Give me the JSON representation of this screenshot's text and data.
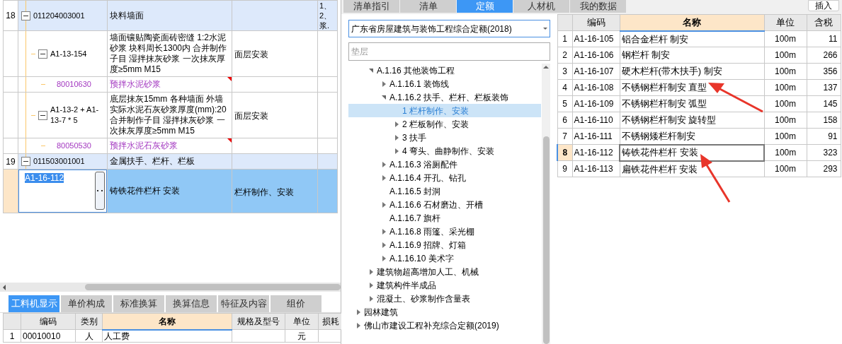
{
  "bill_table": {
    "rows": [
      {
        "kind": "item",
        "number": "18",
        "code": "011204003001",
        "name": "块料墙面",
        "content_lines": [
          "1、",
          "2、",
          "浆."
        ],
        "selected": false,
        "children": [
          {
            "kind": "quota",
            "code": "A1-13-154",
            "name": "墙面镶贴陶瓷面砖密缝 1:2水泥砂浆 块料周长1300内  合并制作子目 湿拌抹灰砂浆 一次抹灰厚度≥5mm M15",
            "feature": "面层安装",
            "selected": false,
            "children": [
              {
                "kind": "material",
                "code": "80010630",
                "name": "预拌水泥砂浆",
                "selected": false
              }
            ]
          },
          {
            "kind": "quota",
            "code": "A1-13-2 + A1-13-7 * 5",
            "name": "底层抹灰15mm 各种墙面 外墙实际水泥石灰砂浆厚度(mm):20  合并制作子目 湿拌抹灰砂浆 一次抹灰厚度≥5mm M15",
            "feature": "面层安装",
            "selected": false,
            "children": [
              {
                "kind": "material",
                "code": "80050530",
                "name": "预拌水泥石灰砂浆",
                "selected": false
              }
            ]
          }
        ]
      },
      {
        "kind": "item",
        "number": "19",
        "code": "011503001001",
        "name": "金属扶手、栏杆、栏板",
        "selected": false,
        "children": [
          {
            "kind": "editing",
            "code": "A1-16-112",
            "name": "铸铁花件栏杆 安装",
            "feature": "栏杆制作、安装",
            "selected": true
          }
        ]
      }
    ]
  },
  "detail_tabs": [
    {
      "label": "工料机显示",
      "selected": true
    },
    {
      "label": "单价构成",
      "selected": false
    },
    {
      "label": "标准换算",
      "selected": false
    },
    {
      "label": "换算信息",
      "selected": false
    },
    {
      "label": "特征及内容",
      "selected": false
    },
    {
      "label": "组价",
      "selected": false
    }
  ],
  "resource_table": {
    "columns": [
      {
        "highlighted": false
      },
      {
        "label": "编码",
        "highlighted": false
      },
      {
        "label": "类别",
        "highlighted": false
      },
      {
        "label": "名称",
        "highlighted": true
      },
      {
        "label": "规格及型号",
        "highlighted": false
      },
      {
        "label": "单位",
        "highlighted": false
      },
      {
        "label": "损耗",
        "highlighted": false
      }
    ],
    "rows": [
      {
        "cells": [
          "1",
          "00010010",
          "人",
          "人工费",
          null,
          "元",
          null
        ]
      }
    ]
  },
  "library_tabs": [
    {
      "label": "清单指引",
      "selected": false
    },
    {
      "label": "清单",
      "selected": false
    },
    {
      "label": "定额",
      "selected": true
    },
    {
      "label": "人材机",
      "selected": false
    },
    {
      "label": "我的数据",
      "selected": false
    }
  ],
  "insert_button": {
    "label": "插入"
  },
  "library_select": {
    "value": "广东省房屋建筑与装饰工程综合定额(2018)"
  },
  "library_search": {
    "placeholder": "垫层"
  },
  "library_tree": {
    "continued_branch": [
      {
        "label": "A.1.16 其他装饰工程",
        "expanded": true,
        "selected": false,
        "children": [
          {
            "label": "A.1.16.1 装饰线",
            "expanded": false,
            "selected": false
          },
          {
            "label": "A.1.16.2 扶手、栏杆、栏板装饰",
            "expanded": true,
            "selected": false,
            "children": [
              {
                "label": "1 栏杆制作、安装",
                "selected": true
              },
              {
                "label": "2 栏板制作、安装",
                "expanded": false,
                "selected": false
              },
              {
                "label": "3 扶手",
                "expanded": false,
                "selected": false
              },
              {
                "label": "4 弯头、曲静制作、安装",
                "expanded": false,
                "selected": false
              }
            ]
          },
          {
            "label": "A.1.16.3 浴厕配件",
            "expanded": false,
            "selected": false
          },
          {
            "label": "A.1.16.4 开孔、钻孔",
            "expanded": false,
            "selected": false
          },
          {
            "label": "A.1.16.5 封洞",
            "selected": false
          },
          {
            "label": "A.1.16.6 石材磨边、开槽",
            "expanded": false,
            "selected": false
          },
          {
            "label": "A.1.16.7 旗杆",
            "selected": false
          },
          {
            "label": "A.1.16.8 雨篷、采光棚",
            "expanded": false,
            "selected": false
          },
          {
            "label": "A.1.16.9 招牌、灯箱",
            "expanded": false,
            "selected": false
          },
          {
            "label": "A.1.16.10 美术字",
            "expanded": false,
            "selected": false
          }
        ]
      },
      {
        "label": "建筑物超高增加人工、机械",
        "expanded": false,
        "selected": false
      },
      {
        "label": "建筑构件半成品",
        "expanded": false,
        "selected": false
      },
      {
        "label": "混凝土、砂浆制作含量表",
        "expanded": false,
        "selected": false
      }
    ],
    "items": [
      {
        "label": "园林建筑",
        "expanded": false,
        "selected": false
      },
      {
        "label": "佛山市建设工程补充综合定额(2019)",
        "expanded": false,
        "selected": false
      }
    ]
  },
  "quota_table": {
    "columns": [
      {
        "highlighted": false
      },
      {
        "label": "编码",
        "highlighted": false
      },
      {
        "label": "名称",
        "highlighted": true
      },
      {
        "label": "单位",
        "highlighted": false
      },
      {
        "label": "含税",
        "highlighted": false
      }
    ],
    "rows": [
      {
        "number": "1",
        "code": "A1-16-105",
        "name": "铝合金栏杆 制安",
        "unit": "100m",
        "price": "11",
        "selected": false
      },
      {
        "number": "2",
        "code": "A1-16-106",
        "name": "钢栏杆 制安",
        "unit": "100m",
        "price": "266",
        "selected": false
      },
      {
        "number": "3",
        "code": "A1-16-107",
        "name": "硬木栏杆(带木扶手) 制安",
        "unit": "100m",
        "price": "356",
        "selected": false
      },
      {
        "number": "4",
        "code": "A1-16-108",
        "name": "不锈钢栏杆制安 直型",
        "unit": "100m",
        "price": "137",
        "selected": false
      },
      {
        "number": "5",
        "code": "A1-16-109",
        "name": "不锈钢栏杆制安 弧型",
        "unit": "100m",
        "price": "145",
        "selected": false
      },
      {
        "number": "6",
        "code": "A1-16-110",
        "name": "不锈钢栏杆制安 旋转型",
        "unit": "100m",
        "price": "158",
        "selected": false
      },
      {
        "number": "7",
        "code": "A1-16-111",
        "name": "不锈钢矮栏杆制安",
        "unit": "100m",
        "price": "91",
        "selected": false
      },
      {
        "number": "8",
        "code": "A1-16-112",
        "name": "铸铁花件栏杆 安装",
        "unit": "100m",
        "price": "323",
        "selected": true
      },
      {
        "number": "9",
        "code": "A1-16-113",
        "name": "扁铁花件栏杆 安装",
        "unit": "100m",
        "price": "293",
        "selected": false
      }
    ]
  }
}
